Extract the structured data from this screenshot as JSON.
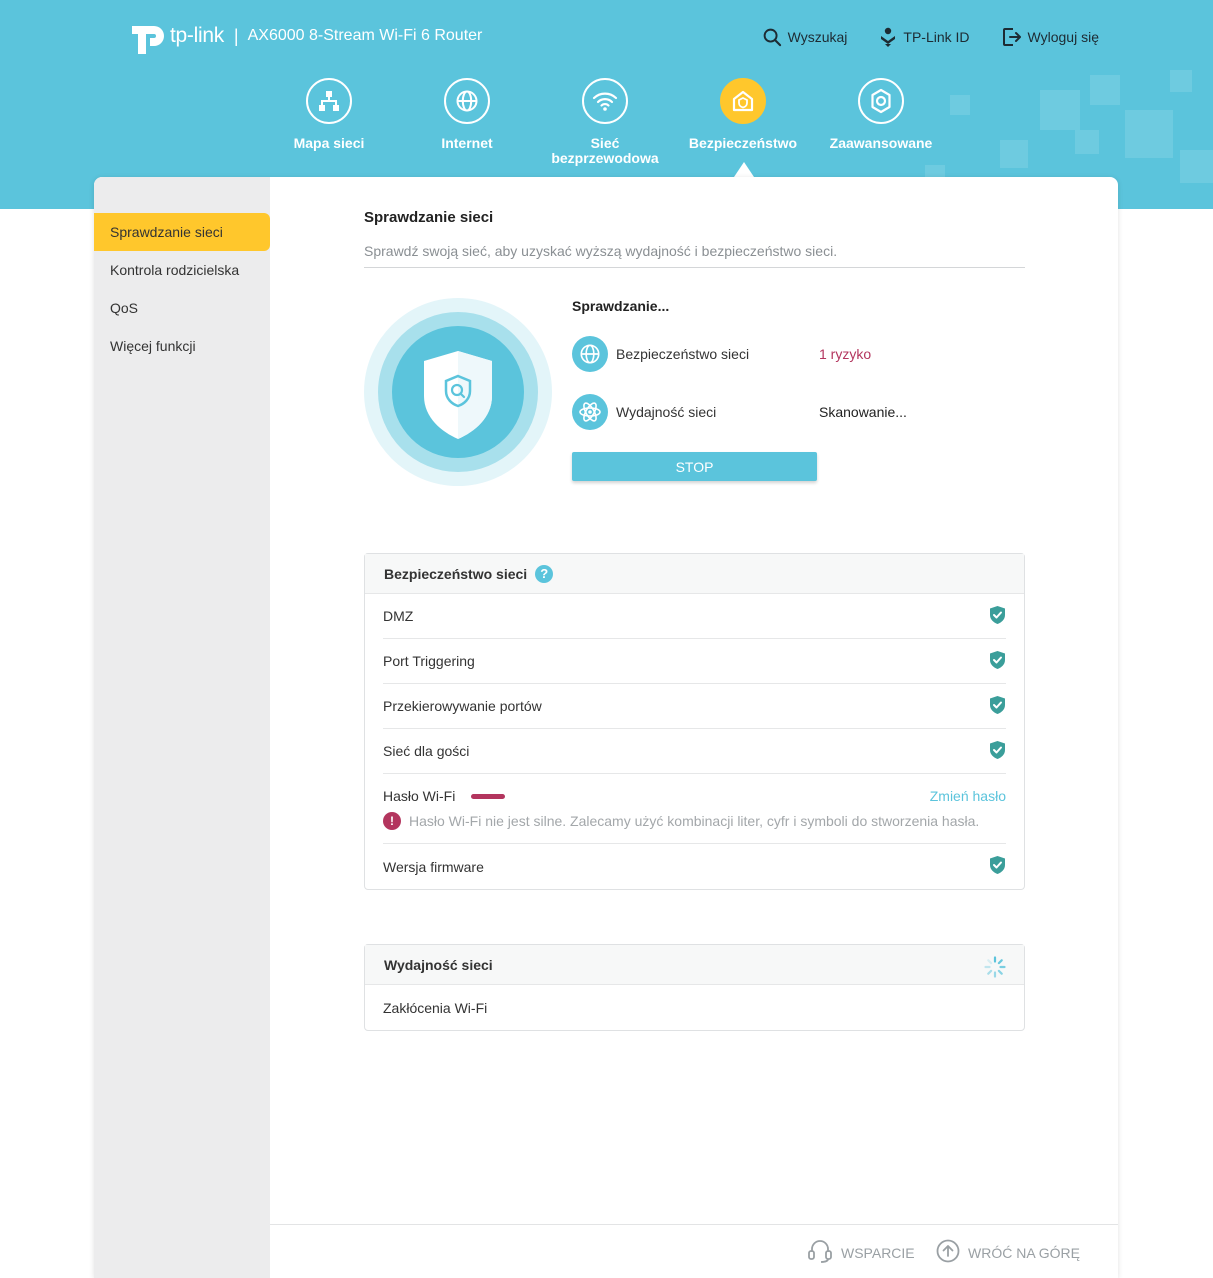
{
  "colors": {
    "accent": "#5bc4dc",
    "active": "#ffc72c",
    "risk": "#b3355e",
    "safe": "#3b9e9a"
  },
  "header": {
    "brand": "tp-link",
    "separator": "|",
    "model": "AX6000 8-Stream Wi-Fi 6 Router",
    "links": [
      {
        "label": "Wyszukaj",
        "icon": "search-icon"
      },
      {
        "label": "TP-Link ID",
        "icon": "tplink-id-icon"
      },
      {
        "label": "Wyloguj się",
        "icon": "logout-icon"
      }
    ]
  },
  "nav": [
    {
      "label": "Mapa sieci",
      "icon": "network-map-icon"
    },
    {
      "label": "Internet",
      "icon": "globe-icon"
    },
    {
      "label": "Sieć bezprzewodowa",
      "icon": "wifi-icon"
    },
    {
      "label": "Bezpieczeństwo",
      "icon": "security-house-icon",
      "active": true
    },
    {
      "label": "Zaawansowane",
      "icon": "advanced-gear-icon"
    }
  ],
  "sidebar": [
    {
      "label": "Sprawdzanie sieci",
      "active": true
    },
    {
      "label": "Kontrola rodzicielska"
    },
    {
      "label": "QoS"
    },
    {
      "label": "Więcej funkcji"
    }
  ],
  "page": {
    "title": "Sprawdzanie sieci",
    "description": "Sprawdź swoją sieć, aby uzyskać wyższą wydajność i bezpieczeństwo sieci."
  },
  "scan": {
    "status": "Sprawdzanie...",
    "security_label": "Bezpieczeństwo sieci",
    "security_value": "1 ryzyko",
    "performance_label": "Wydajność sieci",
    "performance_value": "Skanowanie...",
    "stop_label": "STOP"
  },
  "security_card": {
    "title": "Bezpieczeństwo sieci",
    "help": "?",
    "items": [
      {
        "label": "DMZ",
        "status": "safe"
      },
      {
        "label": "Port Triggering",
        "status": "safe"
      },
      {
        "label": "Przekierowywanie portów",
        "status": "safe"
      },
      {
        "label": "Sieć dla gości",
        "status": "safe"
      }
    ],
    "wifi_password": {
      "label": "Hasło Wi-Fi",
      "strength": "weak",
      "link": "Zmień hasło",
      "warning_mark": "!",
      "warning": "Hasło Wi-Fi nie jest silne. Zalecamy użyć kombinacji liter, cyfr i symboli do stworzenia hasła."
    },
    "firmware": {
      "label": "Wersja firmware",
      "status": "safe"
    }
  },
  "performance_card": {
    "title": "Wydajność sieci",
    "items": [
      {
        "label": "Zakłócenia Wi-Fi"
      }
    ]
  },
  "footer": {
    "support": "WSPARCIE",
    "back_to_top": "WRÓĆ NA GÓRĘ"
  }
}
